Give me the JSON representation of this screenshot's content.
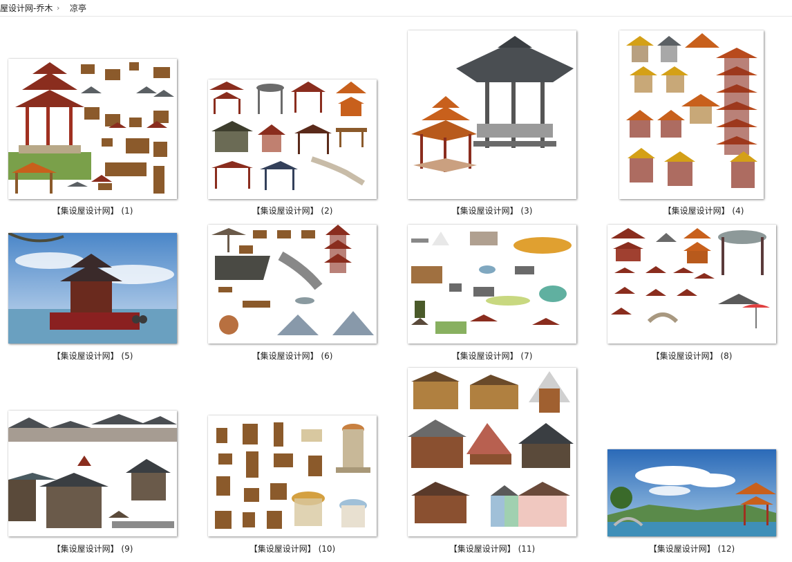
{
  "breadcrumb": {
    "parent": "屋设计网-乔木",
    "separator": "›",
    "current": "凉亭"
  },
  "files": [
    {
      "label": "【集设屋设计网】 (1)",
      "icon": "pavilion-collection-thumbnail"
    },
    {
      "label": "【集设屋设计网】 (2)",
      "icon": "pavilion-collection-thumbnail"
    },
    {
      "label": "【集设屋设计网】 (3)",
      "icon": "two-pavilions-thumbnail"
    },
    {
      "label": "【集设屋设计网】 (4)",
      "icon": "pagoda-collection-thumbnail"
    },
    {
      "label": "【集设屋设计网】 (5)",
      "icon": "pavilion-seaside-scene-thumbnail"
    },
    {
      "label": "【集设屋设计网】 (6)",
      "icon": "garden-elements-thumbnail"
    },
    {
      "label": "【集设屋设计网】 (7)",
      "icon": "fountain-elements-thumbnail"
    },
    {
      "label": "【集设屋设计网】 (8)",
      "icon": "pavilion-umbrella-thumbnail"
    },
    {
      "label": "【集设屋设计网】 (9)",
      "icon": "ancient-buildings-thumbnail"
    },
    {
      "label": "【集设屋设计网】 (10)",
      "icon": "gazebo-buildings-thumbnail"
    },
    {
      "label": "【集设屋设计网】 (11)",
      "icon": "wooden-houses-thumbnail"
    },
    {
      "label": "【集设屋设计网】 (12)",
      "icon": "lake-pavilion-scene-thumbnail"
    }
  ],
  "colors": {
    "roof_red": "#8a2d1e",
    "roof_orange": "#c8601c",
    "roof_gold": "#d4a017",
    "roof_grey": "#5b6064",
    "wood": "#8b5a2b",
    "sky": "#4a86c8",
    "water": "#3f8fb8",
    "grass": "#6a9a3a"
  }
}
